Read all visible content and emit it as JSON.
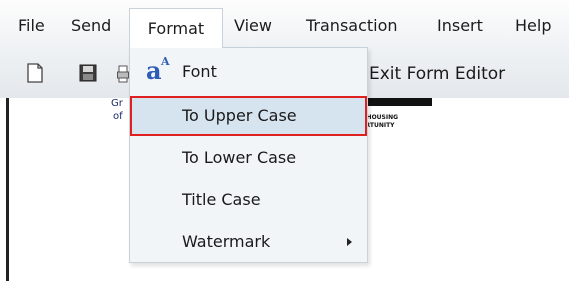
{
  "menubar": {
    "items": [
      {
        "label": "File"
      },
      {
        "label": "Send"
      },
      {
        "label": "Format"
      },
      {
        "label": "View"
      },
      {
        "label": "Transaction"
      },
      {
        "label": "Insert"
      },
      {
        "label": "Help"
      }
    ],
    "active_item": "Format"
  },
  "toolbar": {
    "icons": [
      "new-document-icon",
      "save-icon",
      "print-icon"
    ],
    "exit_form_editor_label": "Exit Form Editor"
  },
  "format_menu": {
    "items": [
      {
        "label": "Font",
        "icon": "font-icon",
        "icon_glyph": "a",
        "icon_sup": "A"
      },
      {
        "label": "To Upper Case",
        "highlighted": true
      },
      {
        "label": "To Lower Case"
      },
      {
        "label": "Title Case"
      },
      {
        "label": "Watermark",
        "has_submenu": true,
        "submenu_glyph": "▸"
      }
    ],
    "highlight_color": "#d6e4f0",
    "highlight_border_color": "#e02020"
  },
  "document": {
    "fragments": [
      "Gr",
      "of"
    ],
    "equal_housing_text": [
      "AL HOUSING",
      "PORTUNITY"
    ]
  },
  "colors": {
    "menubar_bg": "#eef1f4",
    "menu_border": "#c9d1da",
    "font_icon": "#2d5bb8"
  }
}
